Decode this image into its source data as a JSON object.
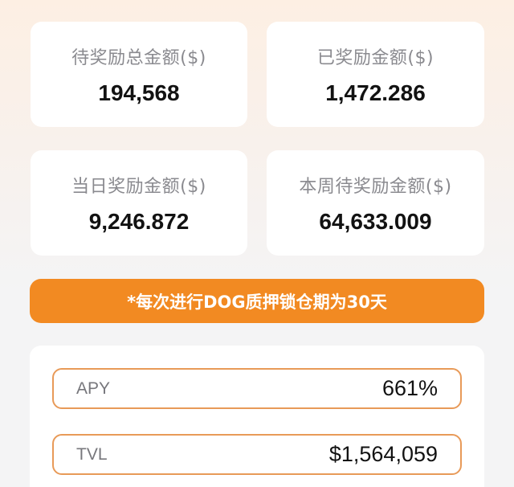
{
  "stats": [
    {
      "label": "待奖励总金额($)",
      "value": "194,568"
    },
    {
      "label": "已奖励金额($)",
      "value": "1,472.286"
    },
    {
      "label": "当日奖励金额($)",
      "value": "9,246.872"
    },
    {
      "label": "本周待奖励金额($)",
      "value": "64,633.009"
    }
  ],
  "notice": "*每次进行DOG质押锁仓期为30天",
  "metrics": [
    {
      "label": "APY",
      "value": "661%"
    },
    {
      "label": "TVL",
      "value": "$1,564,059"
    }
  ],
  "colors": {
    "accent": "#f28a22",
    "row_border": "#e89a58",
    "background": "#f4f4f5",
    "card": "#ffffff"
  }
}
